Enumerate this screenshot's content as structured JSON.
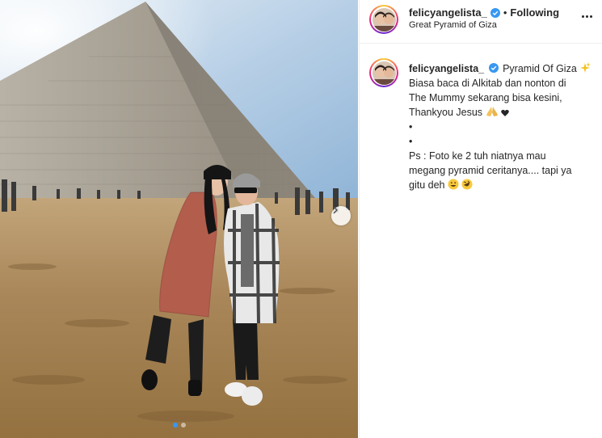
{
  "post": {
    "username": "felicyangelista_",
    "follow_status": "Following",
    "separator": "•",
    "location": "Great Pyramid of Giza",
    "more_icon": "more-horizontal-icon",
    "verified_icon": "verified-badge-icon"
  },
  "caption": {
    "username": "felicyangelista_",
    "lines": [
      "Pyramid Of Giza",
      "Biasa baca di Alkitab dan nonton di",
      "The Mummy sekarang bisa kesini,",
      "Thankyou Jesus",
      "•",
      "•",
      "Ps : Foto ke 2 tuh niatnya mau",
      "megang pyramid ceritanya.... tapi ya",
      "gitu deh"
    ]
  },
  "carousel": {
    "total_slides": 2,
    "active_slide": 1,
    "next_icon": "chevron-right-icon"
  },
  "colors": {
    "accent": "#3897f0",
    "text": "#262626",
    "border": "#efefef"
  }
}
